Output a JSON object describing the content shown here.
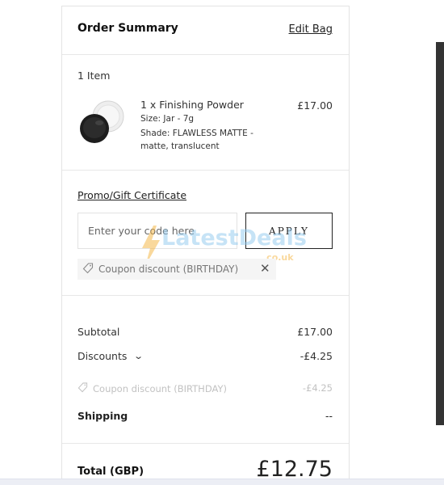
{
  "summary": {
    "title": "Order Summary",
    "edit_bag": "Edit Bag"
  },
  "items": {
    "count_label": "1 Item",
    "products": [
      {
        "name": "1 x Finishing Powder",
        "size": "Size: Jar - 7g",
        "shade": "Shade: FLAWLESS MATTE - matte, translucent",
        "price": "£17.00",
        "image_icon": "powder-jar-icon"
      }
    ]
  },
  "promo": {
    "title": "Promo/Gift Certificate",
    "input_placeholder": "Enter your code here",
    "input_value": "",
    "apply_label": "APPLY",
    "applied_coupon": "Coupon discount (BIRTHDAY)",
    "remove_icon": "close-icon",
    "tag_icon": "tag-icon"
  },
  "watermark": {
    "text": "LatestDeals",
    "sub": ".co.uk"
  },
  "totals": {
    "subtotal_label": "Subtotal",
    "subtotal_value": "£17.00",
    "discounts_label": "Discounts",
    "discounts_value": "-£4.25",
    "coupon_label": "Coupon discount (BIRTHDAY)",
    "coupon_value": "-£4.25",
    "shipping_label": "Shipping",
    "shipping_value": "--"
  },
  "total": {
    "label": "Total (GBP)",
    "value": "£12.75"
  }
}
